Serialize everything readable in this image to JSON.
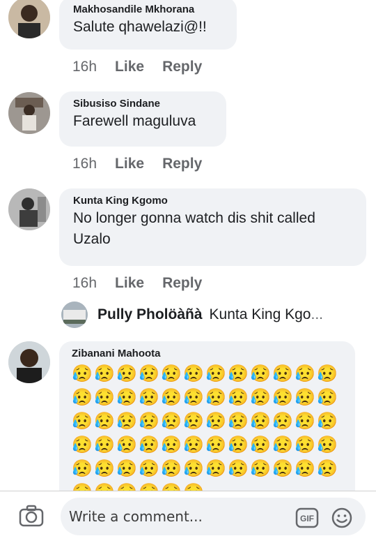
{
  "comments": [
    {
      "author": "Makhosandile Mkhorana",
      "text": "Salute qhawelazi@!!",
      "time": "16h",
      "like": "Like",
      "reply": "Reply"
    },
    {
      "author": "Sibusiso Sindane",
      "text": "Farewell maguluva",
      "time": "16h",
      "like": "Like",
      "reply": "Reply"
    },
    {
      "author": "Kunta King Kgomo",
      "text": "No longer gonna watch dis shit called Uzalo",
      "time": "16h",
      "like": "Like",
      "reply": "Reply"
    },
    {
      "author": "Zibanani Mahoota",
      "emoji": "😥",
      "emoji_count": 66
    }
  ],
  "reply_preview": {
    "author": "Pully Pholöàñà",
    "text": "Kunta King Kgo",
    "ellipsis": "..."
  },
  "composer": {
    "placeholder": "Write a comment...",
    "gif_label": "GIF"
  }
}
